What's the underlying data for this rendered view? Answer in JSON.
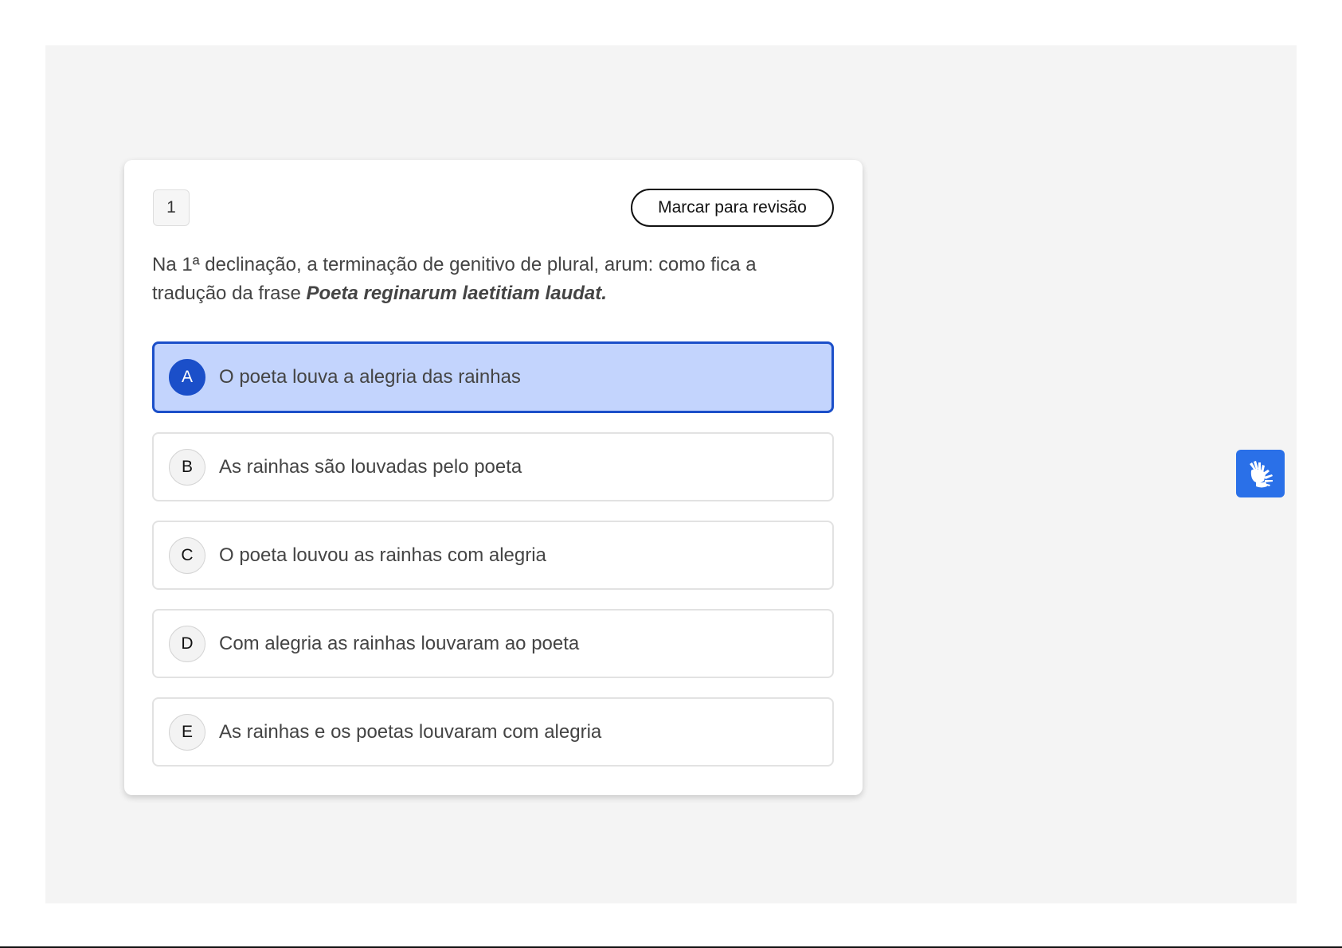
{
  "question": {
    "number": "1",
    "review_label": "Marcar para revisão",
    "statement_prefix": "Na 1ª declinação, a terminação de genitivo de plural, arum:  como fica a tradução da frase ",
    "statement_emphasis": "Poeta reginarum laetitiam laudat."
  },
  "options": [
    {
      "letter": "A",
      "text": "O poeta louva a alegria das rainhas",
      "selected": true
    },
    {
      "letter": "B",
      "text": "As rainhas são louvadas pelo poeta",
      "selected": false
    },
    {
      "letter": "C",
      "text": "O poeta louvou as rainhas com alegria",
      "selected": false
    },
    {
      "letter": "D",
      "text": "Com alegria as rainhas louvaram ao poeta",
      "selected": false
    },
    {
      "letter": "E",
      "text": "As rainhas e os poetas louvaram com alegria",
      "selected": false
    }
  ],
  "accessibility": {
    "icon": "sign-language-hands-icon"
  },
  "colors": {
    "selected_fill": "#c3d4fd",
    "selected_accent": "#1b4fc9",
    "accessibility_button": "#2a70e8",
    "canvas_background": "#f4f4f4"
  }
}
